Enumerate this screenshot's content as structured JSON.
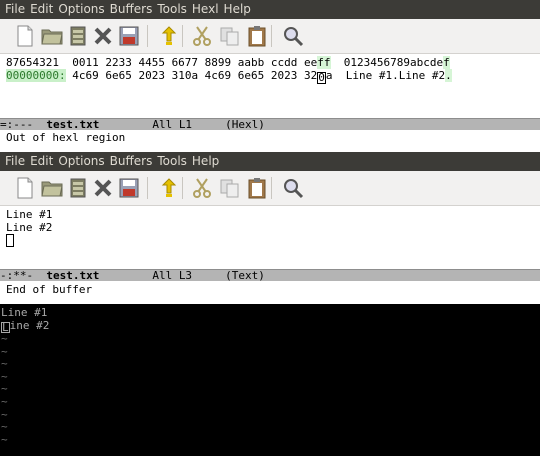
{
  "menu": [
    "File",
    "Edit",
    "Options",
    "Buffers",
    "Tools",
    "Hexl",
    "Help"
  ],
  "menu2": [
    "File",
    "Edit",
    "Options",
    "Buffers",
    "Tools",
    "Help"
  ],
  "toolbar_icons": [
    "new-file-icon",
    "open-folder-icon",
    "save-file-icon",
    "close-icon",
    "save-disk-icon",
    "undo-icon",
    "cut-icon",
    "copy-icon",
    "paste-icon",
    "search-icon"
  ],
  "hexl": {
    "header": "87654321  0011 2233 4455 6677 8899 aabb ccdd ee",
    "header_tail": "ff",
    "header_ascii": "  0123456789abcde",
    "header_ascii_tail": "f",
    "addr": "00000000:",
    "hex_pre": " 4c69 6e65 2023 310a 4c69 6e65 2023 32",
    "hex_cursor": "0",
    "hex_post": "a  ",
    "ascii": "Line #1.Line #2",
    "ascii_tail": ".",
    "modeline_left": "=:---  ",
    "modeline_name": "test.txt",
    "modeline_right": "        All L1     (Hexl)",
    "echo": "Out of hexl region"
  },
  "text": {
    "lines": [
      "Line #1",
      "Line #2"
    ],
    "modeline_left": "-:**-  ",
    "modeline_name": "test.txt",
    "modeline_right": "        All L3     (Text)",
    "echo": "End of buffer"
  },
  "terminal": {
    "line1": "Line #1",
    "line2_rest": "ine #2",
    "line2_first": "L",
    "tilde": "~"
  }
}
